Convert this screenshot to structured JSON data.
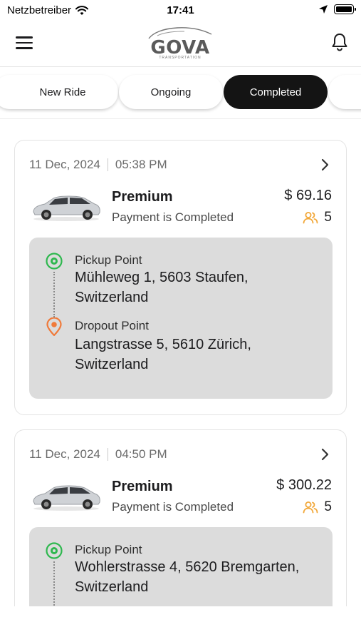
{
  "status_bar": {
    "carrier": "Netzbetreiber",
    "time": "17:41"
  },
  "header": {
    "logo_text": "GOVA",
    "logo_subtext": "TRANSPORTATION"
  },
  "tabs": [
    {
      "label": "New Ride",
      "active": false
    },
    {
      "label": "Ongoing",
      "active": false
    },
    {
      "label": "Completed",
      "active": true
    }
  ],
  "rides": [
    {
      "date": "11 Dec, 2024",
      "time": "05:38 PM",
      "type": "Premium",
      "status": "Payment is Completed",
      "price": "$ 69.16",
      "passengers": "5",
      "pickup_label": "Pickup Point",
      "pickup_address": "Mühleweg 1, 5603 Staufen, Switzerland",
      "dropoff_label": "Dropout Point",
      "dropoff_address": "Langstrasse 5, 5610 Zürich, Switzerland"
    },
    {
      "date": "11 Dec, 2024",
      "time": "04:50 PM",
      "type": "Premium",
      "status": "Payment is Completed",
      "price": "$ 300.22",
      "passengers": "5",
      "pickup_label": "Pickup Point",
      "pickup_address": "Wohlerstrasse 4, 5620 Bremgarten, Switzerland"
    }
  ],
  "colors": {
    "active_tab": "#141414",
    "pickup_icon": "#2fb84f",
    "dropoff_icon": "#f07a3a",
    "passenger_icon": "#f2a83a",
    "route_bg": "#dcdcdc"
  },
  "icons": {
    "menu": "hamburger-menu-icon",
    "bell": "bell-icon",
    "chevron": "chevron-right-icon",
    "pickup": "target-pin-icon",
    "dropoff": "location-pin-icon",
    "passengers": "users-icon"
  }
}
